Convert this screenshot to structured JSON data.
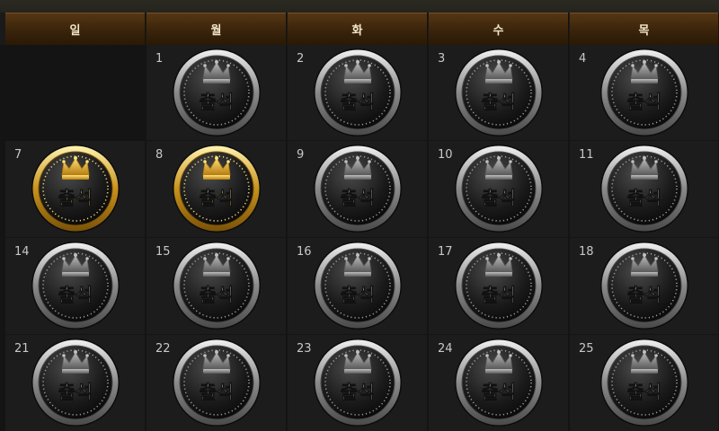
{
  "weekdays": [
    "일",
    "월",
    "화",
    "수",
    "목"
  ],
  "stamp_text": "출석",
  "colors": {
    "header_bg": "#4a2f10",
    "header_text": "#f2e6c8",
    "cell_bg": "#1c1c1c",
    "silver": "#a9a9a9",
    "gold": "#d9a72a"
  },
  "weeks": [
    [
      {
        "day": "",
        "status": "empty"
      },
      {
        "day": "1",
        "status": "silver"
      },
      {
        "day": "2",
        "status": "silver"
      },
      {
        "day": "3",
        "status": "silver"
      },
      {
        "day": "4",
        "status": "silver"
      }
    ],
    [
      {
        "day": "7",
        "status": "gold"
      },
      {
        "day": "8",
        "status": "gold"
      },
      {
        "day": "9",
        "status": "silver"
      },
      {
        "day": "10",
        "status": "silver"
      },
      {
        "day": "11",
        "status": "silver"
      }
    ],
    [
      {
        "day": "14",
        "status": "silver"
      },
      {
        "day": "15",
        "status": "silver"
      },
      {
        "day": "16",
        "status": "silver"
      },
      {
        "day": "17",
        "status": "silver"
      },
      {
        "day": "18",
        "status": "silver"
      }
    ],
    [
      {
        "day": "21",
        "status": "silver"
      },
      {
        "day": "22",
        "status": "silver"
      },
      {
        "day": "23",
        "status": "silver"
      },
      {
        "day": "24",
        "status": "silver"
      },
      {
        "day": "25",
        "status": "silver"
      }
    ]
  ]
}
